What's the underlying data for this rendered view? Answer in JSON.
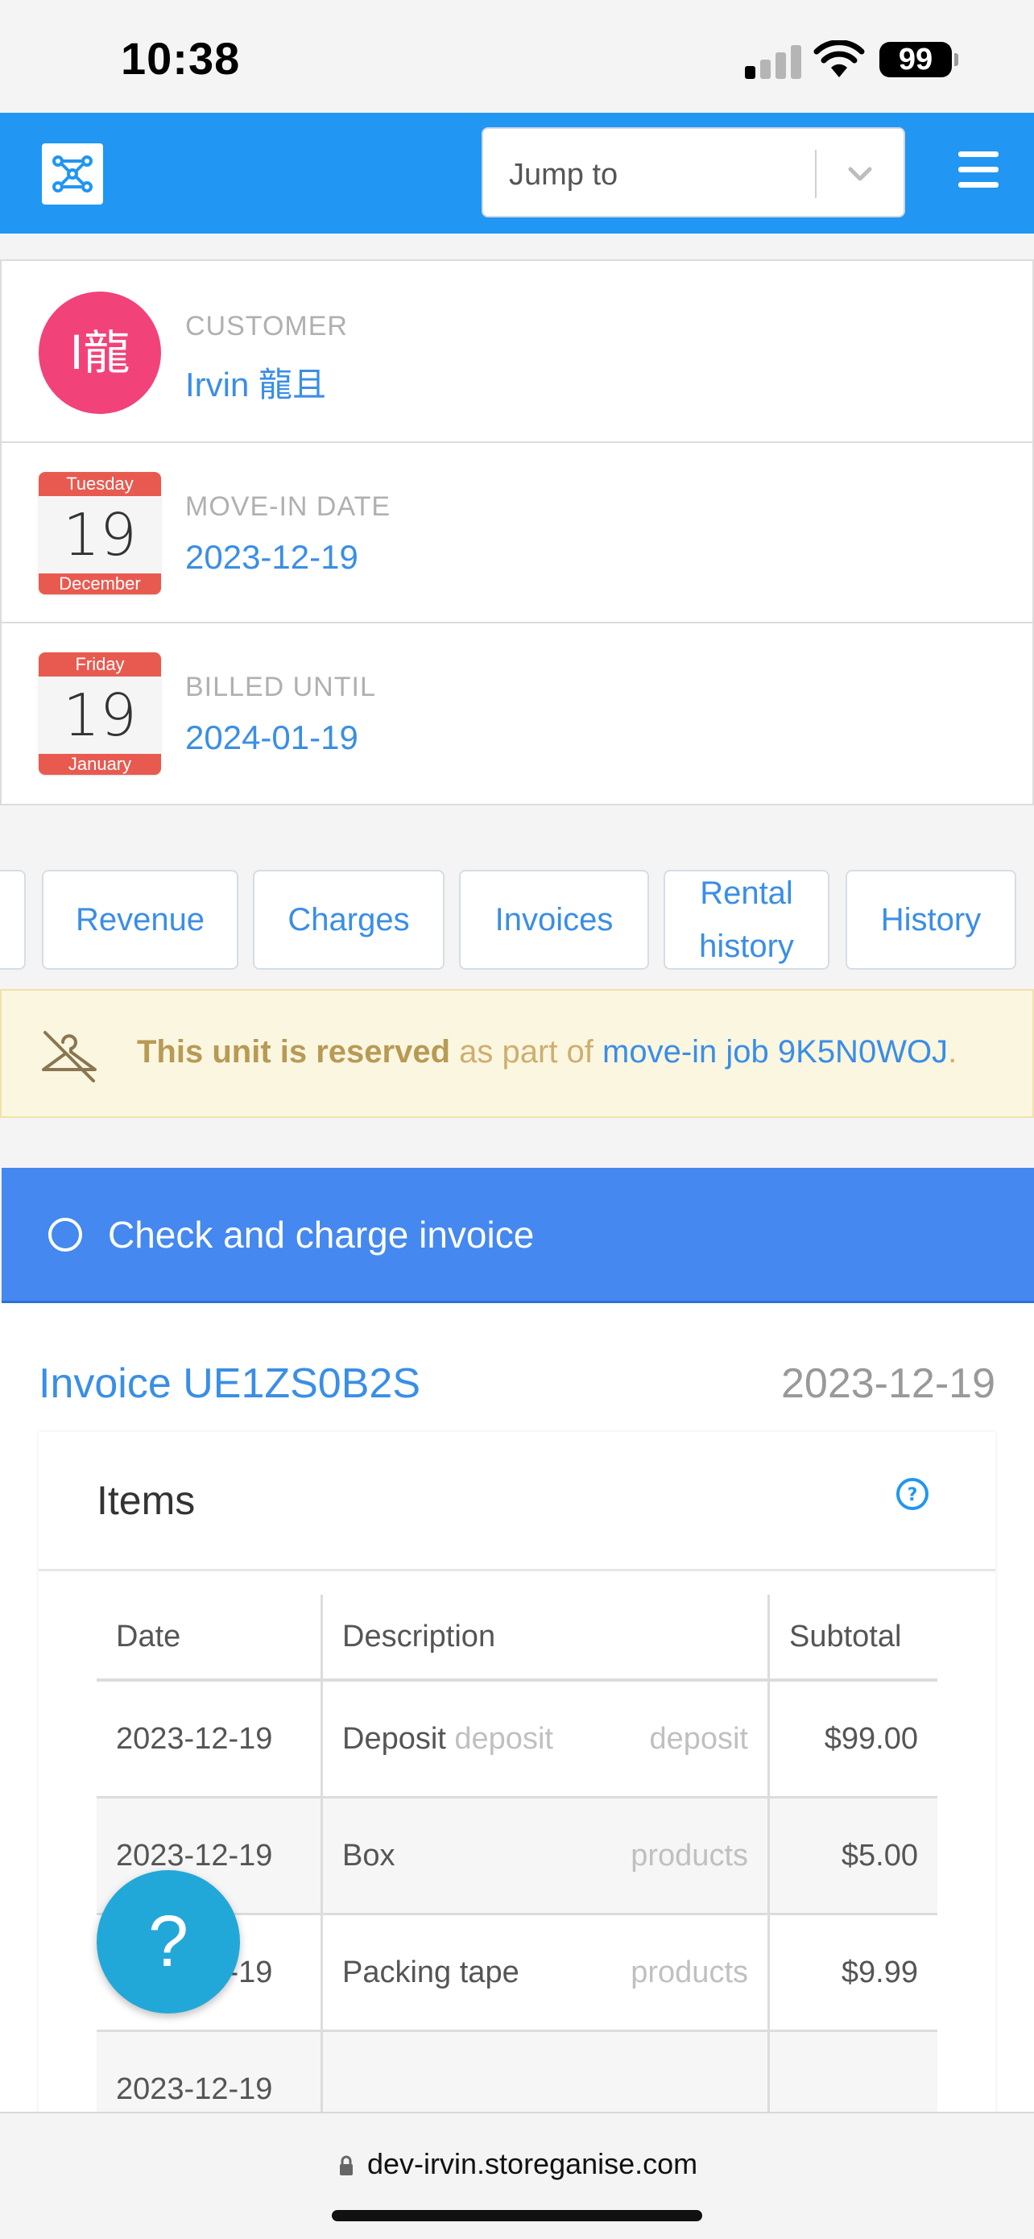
{
  "status_bar": {
    "time": "10:38",
    "battery": "99"
  },
  "header": {
    "jump_placeholder": "Jump to"
  },
  "customer": {
    "avatar_text": "I龍",
    "label": "CUSTOMER",
    "name": "Irvin 龍且"
  },
  "move_in": {
    "weekday": "Tuesday",
    "day": "19",
    "month": "December",
    "label": "MOVE-IN DATE",
    "value": "2023-12-19"
  },
  "billed_until": {
    "weekday": "Friday",
    "day": "19",
    "month": "January",
    "label": "BILLED UNTIL",
    "value": "2024-01-19"
  },
  "tabs": [
    {
      "label": "Revenue"
    },
    {
      "label": "Charges"
    },
    {
      "label": "Invoices"
    },
    {
      "label": "Rental\nhistory"
    },
    {
      "label": "History"
    }
  ],
  "alert": {
    "strong": "This unit is reserved",
    "middle": " as part of ",
    "link": "move-in job 9K5N0WOJ",
    "end": "."
  },
  "action": {
    "label": "Check and charge invoice"
  },
  "invoice": {
    "title": "Invoice UE1ZS0B2S",
    "date": "2023-12-19",
    "items_title": "Items",
    "columns": [
      "Date",
      "Description",
      "Subtotal"
    ],
    "rows": [
      {
        "date": "2023-12-19",
        "desc": "Deposit",
        "desc_extra": "deposit",
        "type": "deposit",
        "subtotal": "$99.00"
      },
      {
        "date": "2023-12-19",
        "desc": "Box",
        "desc_extra": "",
        "type": "products",
        "subtotal": "$5.00"
      },
      {
        "date": "2023-12-19",
        "desc": "Packing tape",
        "desc_extra": "",
        "type": "products",
        "subtotal": "$9.99"
      },
      {
        "date": "2023-12-19",
        "desc": "",
        "desc_extra": "",
        "type": "",
        "subtotal": ""
      }
    ]
  },
  "help_fab": "?",
  "browser": {
    "url": "dev-irvin.storeganise.com"
  },
  "colors": {
    "primary": "#2196f3",
    "link": "#3a8ee6",
    "avatar": "#f2427a",
    "calendar": "#e85a50",
    "action": "#4488f0",
    "alert_bg": "#fbf6e0"
  }
}
